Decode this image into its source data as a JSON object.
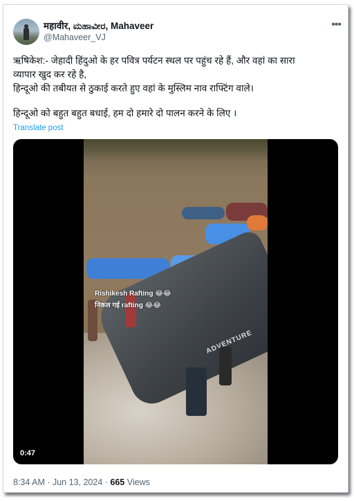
{
  "author": {
    "display_name": "महावीर, ಮಹಾವೀರ, Mahaveer",
    "handle": "@Mahaveer_VJ",
    "avatar_icon": "profile-avatar"
  },
  "more_icon": "more-options-icon",
  "tweet": {
    "lines": [
      "ऋषिकेश:- जेहादी हिंदुओ के हर पवित्र पर्यटन स्थल पर पहुंच रहे हैं, और वहां का सारा",
      "व्यापार खुद कर रहे है,",
      "हिन्दूओ  की तबीयत से ठुकाई करते हुए वहां के मुस्लिम नाव राफ्टिंग वाले।",
      "हिन्दूओ को बहुत बहुत बधाई, हम दो हमारे दो पालन करने के लिए ।"
    ],
    "translate_label": "Translate post"
  },
  "video": {
    "overlay_title": "Rishikesh Rafting 😂😂",
    "overlay_subtitle": "निकल गई rafting 😂😂",
    "raft_text": "ADVENTURE",
    "duration": "0:47"
  },
  "meta": {
    "time": "8:34 AM",
    "separator": " · ",
    "date": "Jun 13, 2024",
    "views_count": "665",
    "views_label": "Views"
  },
  "colors": {
    "link": "#1d9bf0",
    "secondary_text": "#536471",
    "primary_text": "#0f1419"
  }
}
